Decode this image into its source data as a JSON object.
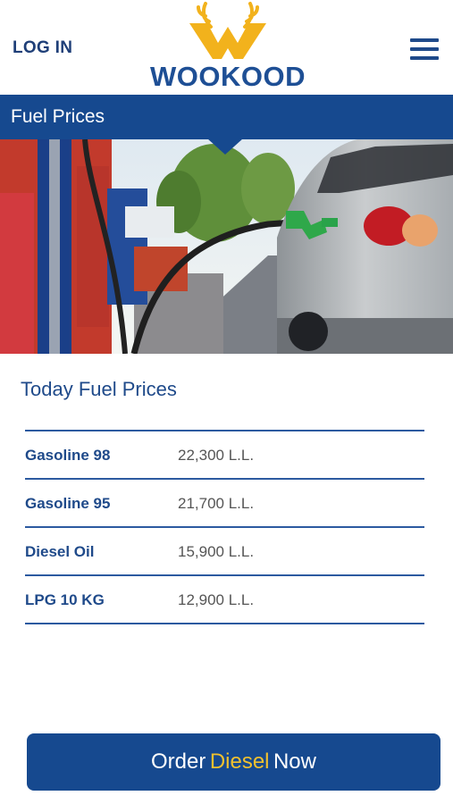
{
  "header": {
    "login_label": "LOG IN",
    "brand_name": "WOOKOOD",
    "brand_color": "#1e4f95",
    "accent_color": "#f2b21c",
    "menu_icon": "hamburger-menu-icon"
  },
  "section": {
    "title": "Fuel Prices",
    "bar_color": "#16498f"
  },
  "hero": {
    "subject": "fuel-pump-nozzle-in-car-photo"
  },
  "prices": {
    "heading": "Today Fuel Prices",
    "rows": [
      {
        "name": "Gasoline 98",
        "price": "22,300 L.L."
      },
      {
        "name": "Gasoline 95",
        "price": "21,700 L.L."
      },
      {
        "name": "Diesel Oil",
        "price": "15,900 L.L."
      },
      {
        "name": "LPG 10 KG",
        "price": "12,900 L.L."
      }
    ]
  },
  "order": {
    "pre": "Order",
    "accent": "Diesel",
    "post": "Now"
  }
}
